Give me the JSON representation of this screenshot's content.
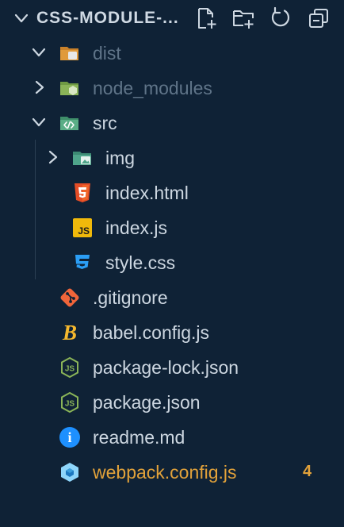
{
  "explorer": {
    "title": "CSS-MODULE-...",
    "actions": [
      {
        "name": "new-file",
        "icon": "new-file-icon"
      },
      {
        "name": "new-folder",
        "icon": "new-folder-icon"
      },
      {
        "name": "refresh",
        "icon": "refresh-icon"
      },
      {
        "name": "collapse-all",
        "icon": "collapse-all-icon"
      }
    ]
  },
  "tree": {
    "dist": {
      "label": "dist",
      "icon": "folder-dist-icon",
      "expanded": true
    },
    "node_modules": {
      "label": "node_modules",
      "icon": "folder-node-icon",
      "expanded": false
    },
    "src": {
      "label": "src",
      "icon": "folder-src-icon",
      "expanded": true
    },
    "img": {
      "label": "img",
      "icon": "folder-images-icon",
      "expanded": false
    },
    "index_html": {
      "label": "index.html",
      "icon": "html5-icon"
    },
    "index_js": {
      "label": "index.js",
      "icon": "javascript-icon",
      "icon_text": "JS"
    },
    "style_css": {
      "label": "style.css",
      "icon": "css3-icon"
    },
    "gitignore": {
      "label": ".gitignore",
      "icon": "git-icon"
    },
    "babel_config": {
      "label": "babel.config.js",
      "icon": "babel-icon",
      "icon_text": "B"
    },
    "package_lock": {
      "label": "package-lock.json",
      "icon": "nodejs-icon"
    },
    "package_json": {
      "label": "package.json",
      "icon": "nodejs-icon"
    },
    "readme": {
      "label": "readme.md",
      "icon": "info-icon",
      "icon_text": "i"
    },
    "webpack_config": {
      "label": "webpack.config.js",
      "icon": "webpack-icon",
      "badge": "4"
    }
  },
  "colors": {
    "background": "#0f2236",
    "text": "#cdd7e1",
    "dim_text": "#5f7488",
    "warning": "#e2a23a",
    "html": "#e44d26",
    "js": "#f0b90b",
    "css": "#2b9ef5",
    "git": "#f0653a",
    "node": "#8ab458",
    "info": "#1e90ff",
    "webpack": "#8ed6fb"
  }
}
